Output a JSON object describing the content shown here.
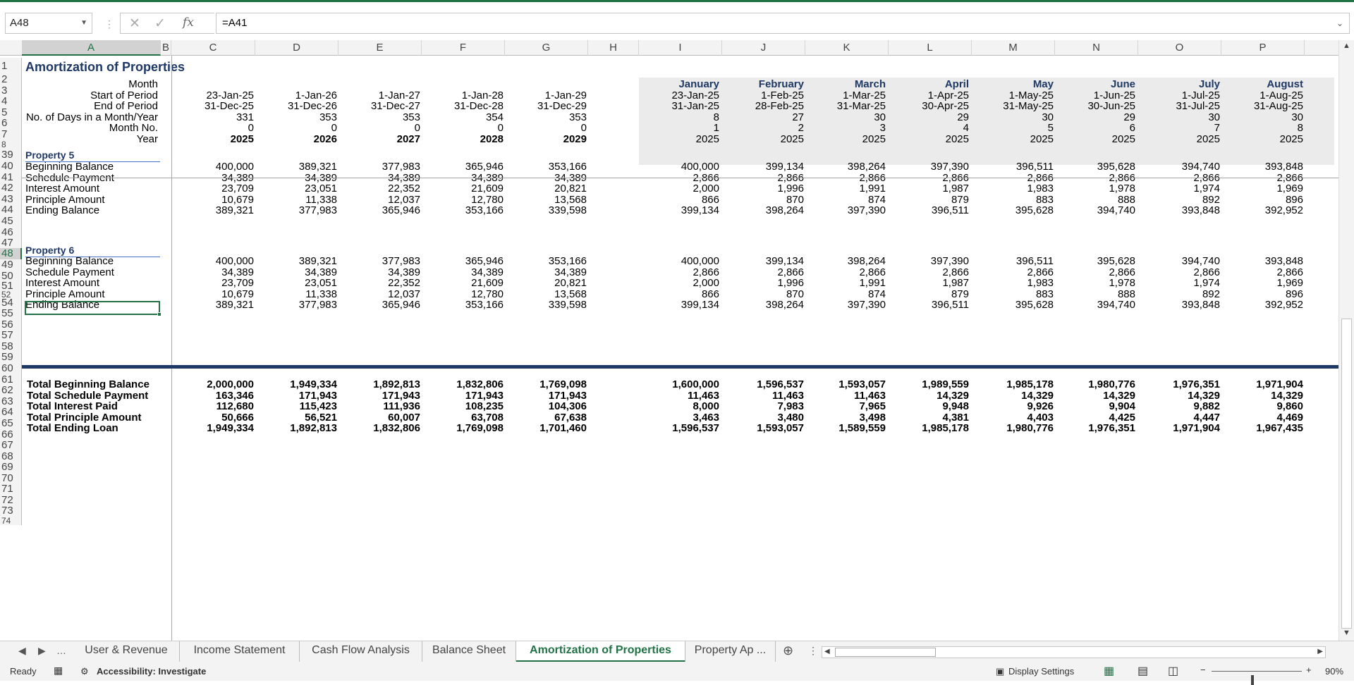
{
  "formula_bar": {
    "name_box": "A48",
    "formula": "=A41",
    "fx": "fx"
  },
  "columns": [
    "A",
    "B",
    "C",
    "D",
    "E",
    "F",
    "G",
    "H",
    "I",
    "J",
    "K",
    "L",
    "M",
    "N",
    "O",
    "P"
  ],
  "row_numbers": [
    "1",
    "2",
    "3",
    "4",
    "5",
    "6",
    "7",
    "8",
    "39",
    "40",
    "41",
    "42",
    "43",
    "44",
    "45",
    "46",
    "47",
    "48",
    "49",
    "50",
    "51",
    "52",
    "54",
    "55",
    "56",
    "57",
    "58",
    "59",
    "60",
    "61",
    "62",
    "63",
    "64",
    "65",
    "66",
    "67",
    "68",
    "69",
    "70",
    "71",
    "72",
    "73",
    "74"
  ],
  "title": "Amortization of Properties",
  "labels": {
    "month": "Month",
    "start": "Start of Period",
    "end": "End of Period",
    "days": "No. of Days in a Month/Year",
    "monthno": "Month No.",
    "year": "Year"
  },
  "months": [
    "January",
    "February",
    "March",
    "April",
    "May",
    "June",
    "July",
    "August"
  ],
  "start_row": [
    "23-Jan-25",
    "1-Jan-26",
    "1-Jan-27",
    "1-Jan-28",
    "1-Jan-29",
    "23-Jan-25",
    "1-Feb-25",
    "1-Mar-25",
    "1-Apr-25",
    "1-May-25",
    "1-Jun-25",
    "1-Jul-25",
    "1-Aug-25"
  ],
  "end_row": [
    "31-Dec-25",
    "31-Dec-26",
    "31-Dec-27",
    "31-Dec-28",
    "31-Dec-29",
    "31-Jan-25",
    "28-Feb-25",
    "31-Mar-25",
    "30-Apr-25",
    "31-May-25",
    "30-Jun-25",
    "31-Jul-25",
    "31-Aug-25"
  ],
  "days_row": [
    "331",
    "353",
    "353",
    "354",
    "353",
    "8",
    "27",
    "30",
    "29",
    "30",
    "29",
    "30",
    "30"
  ],
  "monthno_row": [
    "0",
    "0",
    "0",
    "0",
    "0",
    "1",
    "2",
    "3",
    "4",
    "5",
    "6",
    "7",
    "8"
  ],
  "year_row": [
    "2025",
    "2026",
    "2027",
    "2028",
    "2029",
    "2025",
    "2025",
    "2025",
    "2025",
    "2025",
    "2025",
    "2025",
    "2025"
  ],
  "property5": {
    "name": "Property 5",
    "rows": [
      {
        "label": "Beginning Balance",
        "values": [
          "400,000",
          "389,321",
          "377,983",
          "365,946",
          "353,166",
          "400,000",
          "399,134",
          "398,264",
          "397,390",
          "396,511",
          "395,628",
          "394,740",
          "393,848"
        ]
      },
      {
        "label": "Schedule Payment",
        "values": [
          "34,389",
          "34,389",
          "34,389",
          "34,389",
          "34,389",
          "2,866",
          "2,866",
          "2,866",
          "2,866",
          "2,866",
          "2,866",
          "2,866",
          "2,866"
        ]
      },
      {
        "label": "Interest Amount",
        "values": [
          "23,709",
          "23,051",
          "22,352",
          "21,609",
          "20,821",
          "2,000",
          "1,996",
          "1,991",
          "1,987",
          "1,983",
          "1,978",
          "1,974",
          "1,969"
        ]
      },
      {
        "label": "Principle Amount",
        "values": [
          "10,679",
          "11,338",
          "12,037",
          "12,780",
          "13,568",
          "866",
          "870",
          "874",
          "879",
          "883",
          "888",
          "892",
          "896"
        ]
      },
      {
        "label": "Ending Balance",
        "values": [
          "389,321",
          "377,983",
          "365,946",
          "353,166",
          "339,598",
          "399,134",
          "398,264",
          "397,390",
          "396,511",
          "395,628",
          "394,740",
          "393,848",
          "392,952"
        ]
      }
    ]
  },
  "property6": {
    "name": "Property 6",
    "rows": [
      {
        "label": "Beginning Balance",
        "values": [
          "400,000",
          "389,321",
          "377,983",
          "365,946",
          "353,166",
          "400,000",
          "399,134",
          "398,264",
          "397,390",
          "396,511",
          "395,628",
          "394,740",
          "393,848"
        ]
      },
      {
        "label": "Schedule Payment",
        "values": [
          "34,389",
          "34,389",
          "34,389",
          "34,389",
          "34,389",
          "2,866",
          "2,866",
          "2,866",
          "2,866",
          "2,866",
          "2,866",
          "2,866",
          "2,866"
        ]
      },
      {
        "label": "Interest Amount",
        "values": [
          "23,709",
          "23,051",
          "22,352",
          "21,609",
          "20,821",
          "2,000",
          "1,996",
          "1,991",
          "1,987",
          "1,983",
          "1,978",
          "1,974",
          "1,969"
        ]
      },
      {
        "label": "Principle Amount",
        "values": [
          "10,679",
          "11,338",
          "12,037",
          "12,780",
          "13,568",
          "866",
          "870",
          "874",
          "879",
          "883",
          "888",
          "892",
          "896"
        ]
      },
      {
        "label": "Ending Balance",
        "values": [
          "389,321",
          "377,983",
          "365,946",
          "353,166",
          "339,598",
          "399,134",
          "398,264",
          "397,390",
          "396,511",
          "395,628",
          "394,740",
          "393,848",
          "392,952"
        ]
      }
    ]
  },
  "totals": [
    {
      "label": "Total Beginning Balance",
      "values": [
        "2,000,000",
        "1,949,334",
        "1,892,813",
        "1,832,806",
        "1,769,098",
        "1,600,000",
        "1,596,537",
        "1,593,057",
        "1,989,559",
        "1,985,178",
        "1,980,776",
        "1,976,351",
        "1,971,904"
      ]
    },
    {
      "label": "Total Schedule Payment",
      "values": [
        "163,346",
        "171,943",
        "171,943",
        "171,943",
        "171,943",
        "11,463",
        "11,463",
        "11,463",
        "14,329",
        "14,329",
        "14,329",
        "14,329",
        "14,329"
      ]
    },
    {
      "label": "Total Interest Paid",
      "values": [
        "112,680",
        "115,423",
        "111,936",
        "108,235",
        "104,306",
        "8,000",
        "7,983",
        "7,965",
        "9,948",
        "9,926",
        "9,904",
        "9,882",
        "9,860"
      ]
    },
    {
      "label": "Total Principle Amount",
      "values": [
        "50,666",
        "56,521",
        "60,007",
        "63,708",
        "67,638",
        "3,463",
        "3,480",
        "3,498",
        "4,381",
        "4,403",
        "4,425",
        "4,447",
        "4,469"
      ]
    },
    {
      "label": "Total Ending Loan",
      "values": [
        "1,949,334",
        "1,892,813",
        "1,832,806",
        "1,769,098",
        "1,701,460",
        "1,596,537",
        "1,593,057",
        "1,589,559",
        "1,985,178",
        "1,980,776",
        "1,976,351",
        "1,971,904",
        "1,967,435"
      ]
    }
  ],
  "sheet_tabs": [
    "User & Revenue",
    "Income Statement",
    "Cash Flow Analysis",
    "Balance Sheet",
    "Amortization of Properties",
    "Property Ap ..."
  ],
  "active_tab": "Amortization of Properties",
  "status": {
    "ready": "Ready",
    "accessibility": "Accessibility: Investigate",
    "display": "Display Settings",
    "zoom": "90%",
    "zoom_fraction": 0.45
  },
  "colors": {
    "accent": "#217346",
    "navy": "#1f3864",
    "underline": "#4472c4"
  }
}
